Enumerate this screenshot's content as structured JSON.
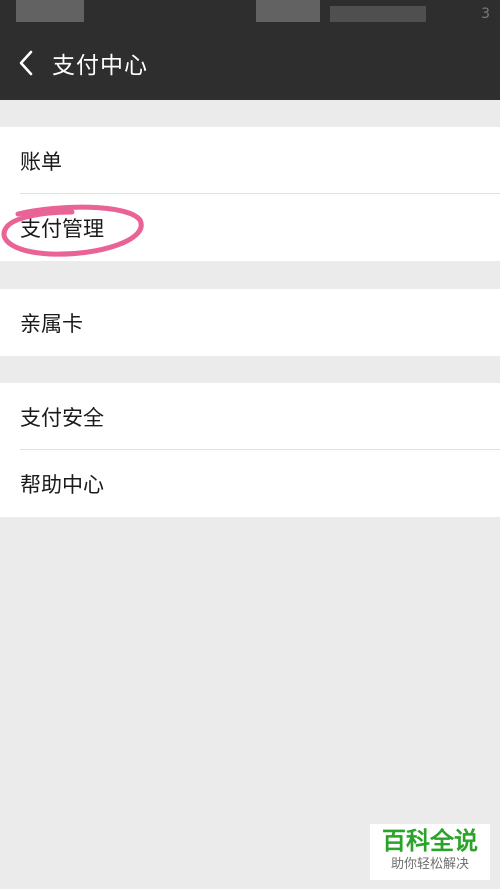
{
  "header": {
    "title": "支付中心",
    "back_icon": "chevron-left-icon",
    "status_number": "3"
  },
  "menu_groups": [
    {
      "items": [
        {
          "label": "账单"
        },
        {
          "label": "支付管理"
        }
      ]
    },
    {
      "items": [
        {
          "label": "亲属卡"
        }
      ]
    },
    {
      "items": [
        {
          "label": "支付安全"
        },
        {
          "label": "帮助中心"
        }
      ]
    }
  ],
  "annotation": {
    "highlighted_item": "支付管理",
    "color": "#e8528c"
  },
  "watermark": {
    "title": "百科全说",
    "subtitle": "助你轻松解决"
  },
  "colors": {
    "nav_bg": "#2e2e2e",
    "page_bg": "#ebebeb",
    "row_bg": "#ffffff",
    "watermark_green": "#2aa32a"
  }
}
